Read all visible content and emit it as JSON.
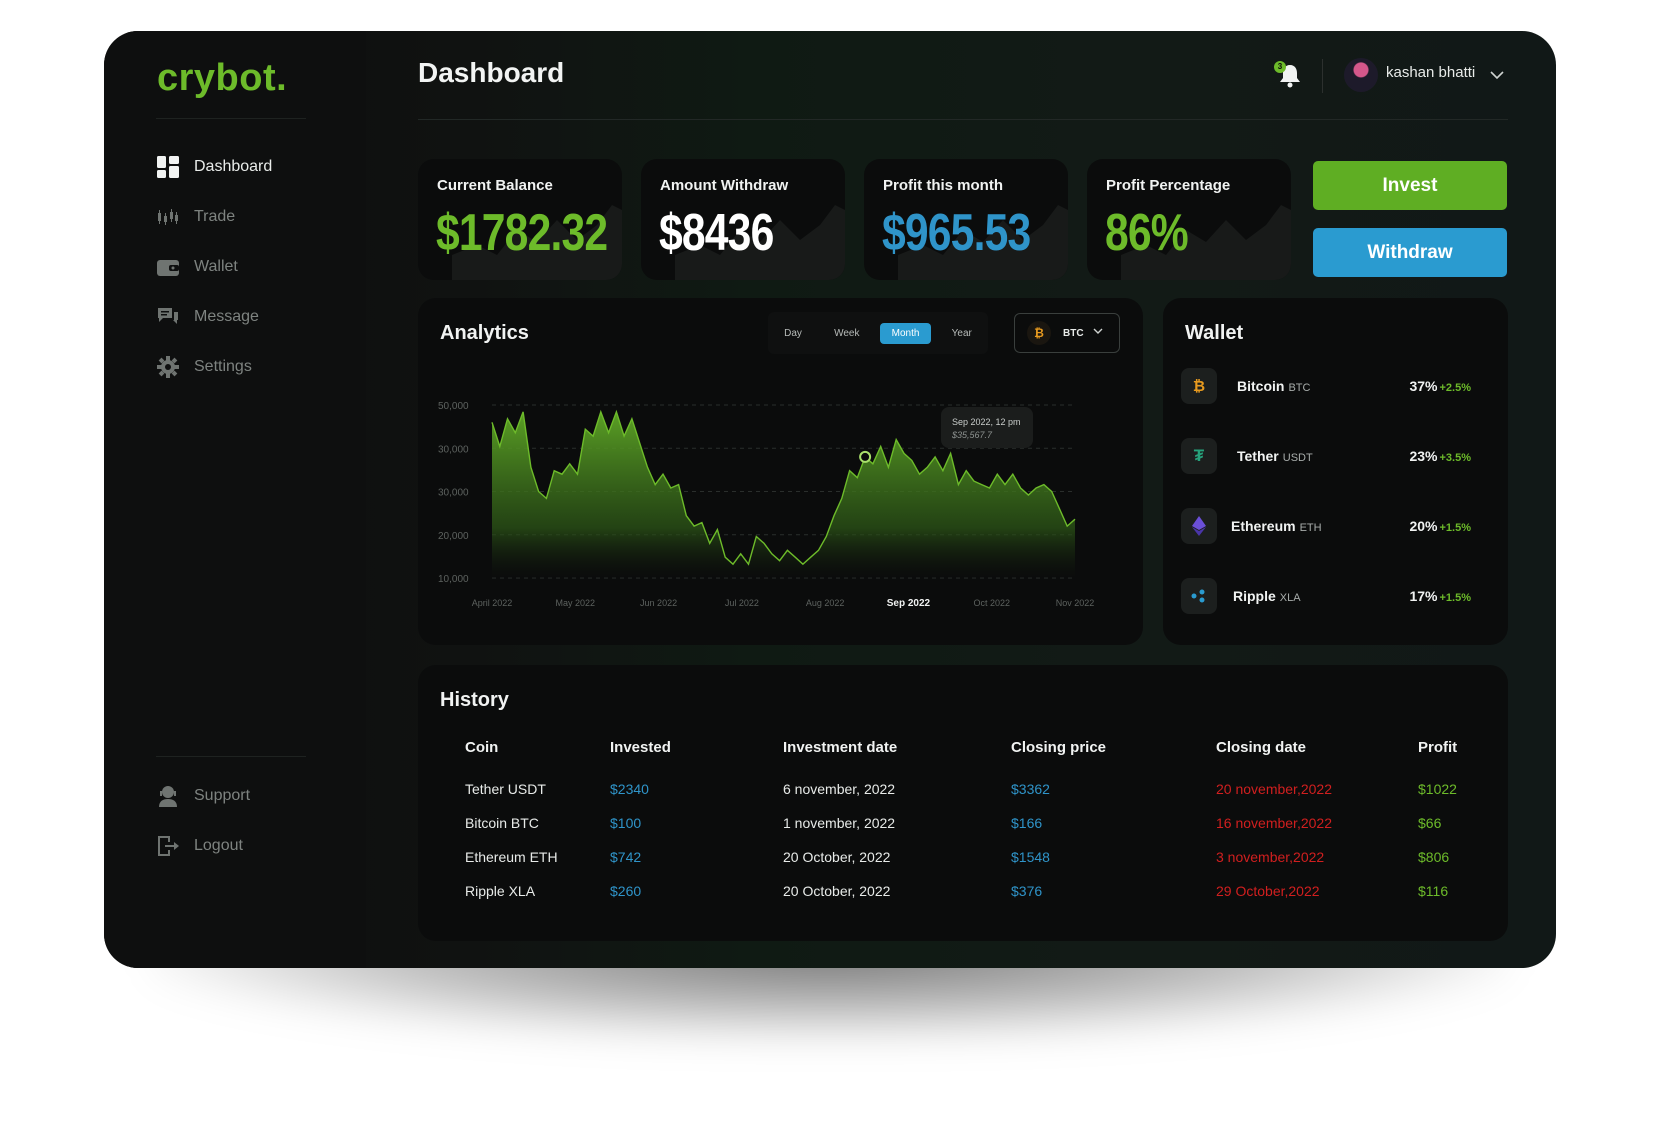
{
  "app": {
    "logo": "crybot."
  },
  "sidebar": {
    "items": [
      {
        "label": "Dashboard",
        "icon": "grid-icon",
        "active": true
      },
      {
        "label": "Trade",
        "icon": "candlestick-icon"
      },
      {
        "label": "Wallet",
        "icon": "wallet-icon"
      },
      {
        "label": "Message",
        "icon": "chat-icon"
      },
      {
        "label": "Settings",
        "icon": "gear-icon"
      }
    ],
    "bottom": [
      {
        "label": "Support",
        "icon": "support-icon"
      },
      {
        "label": "Logout",
        "icon": "logout-icon"
      }
    ]
  },
  "header": {
    "title": "Dashboard",
    "notification_count": "3",
    "user_name": "kashan bhatti"
  },
  "stats": [
    {
      "label": "Current Balance",
      "value": "$1782.32",
      "color": "#6dbb2a"
    },
    {
      "label": "Amount Withdraw",
      "value": "$8436",
      "color": "#ffffff"
    },
    {
      "label": "Profit this month",
      "value": "$965.53",
      "color": "#2f94c9"
    },
    {
      "label": "Profit Percentage",
      "value": "86%",
      "color": "#6dbb2a"
    }
  ],
  "actions": {
    "invest": "Invest",
    "withdraw": "Withdraw",
    "invest_color": "#5fae23",
    "withdraw_color": "#2a9bd0"
  },
  "analytics": {
    "title": "Analytics",
    "tabs": [
      "Day",
      "Week",
      "Month",
      "Year"
    ],
    "active_tab": "Month",
    "coin": "BTC",
    "tooltip": {
      "date": "Sep 2022, 12 pm",
      "value": "$35,567.7"
    }
  },
  "chart_data": {
    "type": "area",
    "y_tick_labels": [
      "50,000",
      "30,000",
      "30,000",
      "20,000",
      "10,000"
    ],
    "x_tick_labels": [
      "April 2022",
      "May 2022",
      "Jun 2022",
      "Jul 2022",
      "Aug 2022",
      "Sep 2022",
      "Oct 2022",
      "Nov 2022"
    ],
    "highlight_x": "Sep 2022",
    "ylim": [
      0,
      50000
    ],
    "series": [
      {
        "values": [
          45000,
          38000,
          46000,
          42000,
          48000,
          32000,
          25000,
          23000,
          31000,
          30000,
          33000,
          30000,
          43000,
          41000,
          48000,
          42000,
          48000,
          41000,
          46000,
          39000,
          32000,
          27000,
          30000,
          26000,
          27000,
          18000,
          15000,
          16000,
          10000,
          14000,
          6000,
          4000,
          7000,
          4000,
          12000,
          10000,
          7000,
          5000,
          8000,
          6000,
          4000,
          6000,
          8000,
          12000,
          18000,
          23000,
          31000,
          29000,
          35000,
          33000,
          38000,
          32000,
          40000,
          36000,
          34000,
          30000,
          32000,
          35000,
          31000,
          36000,
          27000,
          31000,
          28000,
          27000,
          26000,
          30000,
          27000,
          30000,
          26000,
          24000,
          26000,
          27000,
          25000,
          20000,
          15000,
          17000
        ]
      }
    ],
    "grid": true,
    "series_color": "#6dbb2a"
  },
  "wallet": {
    "title": "Wallet",
    "items": [
      {
        "name": "Bitcoin",
        "symbol": "BTC",
        "percent": "37%",
        "change": "+2.5%",
        "icon": "bitcoin-icon",
        "icon_color": "#e79a1f"
      },
      {
        "name": "Tether",
        "symbol": "USDT",
        "percent": "23%",
        "change": "+3.5%",
        "icon": "tether-icon",
        "icon_color": "#26a17b"
      },
      {
        "name": "Ethereum",
        "symbol": "ETH",
        "percent": "20%",
        "change": "+1.5%",
        "icon": "ethereum-icon",
        "icon_color": "#6b4fd8"
      },
      {
        "name": "Ripple",
        "symbol": "XLA",
        "percent": "17%",
        "change": "+1.5%",
        "icon": "ripple-icon",
        "icon_color": "#2a9bd0"
      }
    ]
  },
  "history": {
    "title": "History",
    "columns": [
      "Coin",
      "Invested",
      "Investment date",
      "Closing price",
      "Closing date",
      "Profit"
    ],
    "rows": [
      [
        "Tether USDT",
        "$2340",
        "6 november, 2022",
        "$3362",
        "20 november,2022",
        "$1022"
      ],
      [
        "Bitcoin BTC",
        "$100",
        "1 november, 2022",
        "$166",
        "16 november,2022",
        "$66"
      ],
      [
        "Ethereum ETH",
        "$742",
        "20 October, 2022",
        "$1548",
        "3 november,2022",
        "$806"
      ],
      [
        "Ripple XLA",
        "$260",
        "20 October, 2022",
        "$376",
        "29 October,2022",
        "$116"
      ]
    ]
  }
}
